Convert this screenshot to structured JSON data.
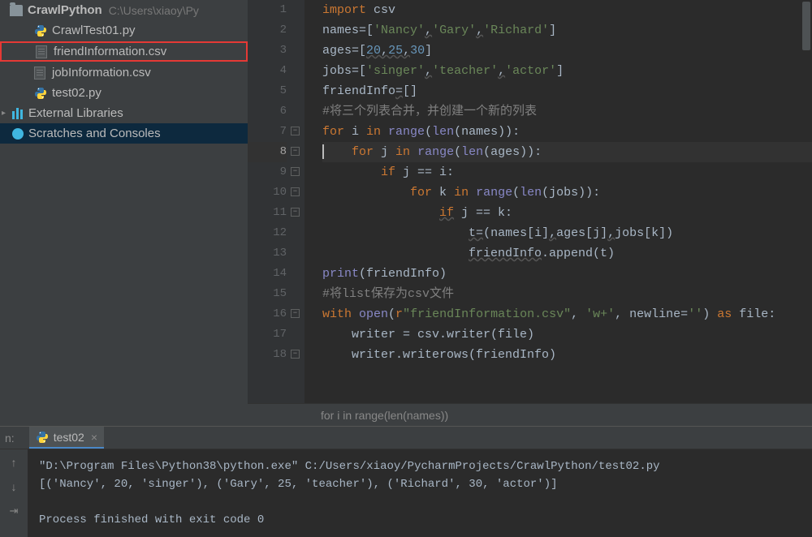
{
  "sidebar": {
    "root": {
      "name": "CrawlPython",
      "path": "C:\\Users\\xiaoy\\Py"
    },
    "files": [
      {
        "name": "CrawlTest01.py",
        "type": "py"
      },
      {
        "name": "friendInformation.csv",
        "type": "csv",
        "highlight": true
      },
      {
        "name": "jobInformation.csv",
        "type": "csv"
      },
      {
        "name": "test02.py",
        "type": "py"
      }
    ],
    "external": "External Libraries",
    "scratches": "Scratches and Consoles"
  },
  "editor": {
    "lines": [
      {
        "n": 1,
        "tokens": [
          [
            "kw",
            "import "
          ],
          [
            "id",
            "csv"
          ]
        ]
      },
      {
        "n": 2,
        "tokens": [
          [
            "id",
            "names"
          ],
          [
            "op",
            "=["
          ],
          [
            "str",
            "'Nancy'"
          ],
          [
            "op uline",
            ","
          ],
          [
            "str",
            "'Gary'"
          ],
          [
            "op uline",
            ","
          ],
          [
            "str",
            "'Richard'"
          ],
          [
            "op",
            "]"
          ]
        ]
      },
      {
        "n": 3,
        "tokens": [
          [
            "id",
            "ages"
          ],
          [
            "op",
            "=["
          ],
          [
            "num uline",
            "20"
          ],
          [
            "op uline",
            ","
          ],
          [
            "num uline",
            "25"
          ],
          [
            "op uline",
            ","
          ],
          [
            "num",
            "30"
          ],
          [
            "op",
            "]"
          ]
        ]
      },
      {
        "n": 4,
        "tokens": [
          [
            "id",
            "jobs"
          ],
          [
            "op",
            "=["
          ],
          [
            "str",
            "'singer'"
          ],
          [
            "op uline",
            ","
          ],
          [
            "str",
            "'teacher'"
          ],
          [
            "op uline",
            ","
          ],
          [
            "str",
            "'actor'"
          ],
          [
            "op",
            "]"
          ]
        ]
      },
      {
        "n": 5,
        "tokens": [
          [
            "id",
            "friendInfo"
          ],
          [
            "op uline",
            "="
          ],
          [
            "op",
            "[]"
          ]
        ]
      },
      {
        "n": 6,
        "tokens": [
          [
            "comment",
            "#将三个列表合并，并创建一个新的列表"
          ]
        ]
      },
      {
        "n": 7,
        "fold": true,
        "tokens": [
          [
            "kw",
            "for "
          ],
          [
            "id",
            "i "
          ],
          [
            "kw",
            "in "
          ],
          [
            "builtin",
            "range"
          ],
          [
            "op",
            "("
          ],
          [
            "builtin",
            "len"
          ],
          [
            "op",
            "(names)):"
          ]
        ]
      },
      {
        "n": 8,
        "fold": true,
        "current": true,
        "tokens": [
          [
            "caret",
            ""
          ],
          [
            "id",
            "    "
          ],
          [
            "kw",
            "for "
          ],
          [
            "id",
            "j "
          ],
          [
            "kw",
            "in "
          ],
          [
            "builtin",
            "range"
          ],
          [
            "op",
            "("
          ],
          [
            "builtin",
            "len"
          ],
          [
            "op",
            "(ages)):"
          ]
        ]
      },
      {
        "n": 9,
        "fold": true,
        "tokens": [
          [
            "id",
            "        "
          ],
          [
            "kw",
            "if "
          ],
          [
            "id",
            "j == i:"
          ]
        ]
      },
      {
        "n": 10,
        "fold": true,
        "tokens": [
          [
            "id",
            "            "
          ],
          [
            "kw",
            "for "
          ],
          [
            "id",
            "k "
          ],
          [
            "kw",
            "in "
          ],
          [
            "builtin",
            "range"
          ],
          [
            "op",
            "("
          ],
          [
            "builtin",
            "len"
          ],
          [
            "op",
            "(jobs)):"
          ]
        ]
      },
      {
        "n": 11,
        "fold": true,
        "tokens": [
          [
            "id",
            "                "
          ],
          [
            "kw uline",
            "if"
          ],
          [
            "id",
            " j == k:"
          ]
        ]
      },
      {
        "n": 12,
        "tokens": [
          [
            "id",
            "                    "
          ],
          [
            "id uline",
            "t"
          ],
          [
            "op uline",
            "="
          ],
          [
            "op",
            "(names[i]"
          ],
          [
            "op uline",
            ","
          ],
          [
            "op",
            "ages[j]"
          ],
          [
            "op uline",
            ","
          ],
          [
            "op",
            "jobs[k])"
          ]
        ]
      },
      {
        "n": 13,
        "tokens": [
          [
            "id",
            "                    "
          ],
          [
            "id uline",
            "friendInfo"
          ],
          [
            "op",
            ".append(t)"
          ]
        ]
      },
      {
        "n": 14,
        "tokens": [
          [
            "builtin",
            "print"
          ],
          [
            "op",
            "(friendInfo)"
          ]
        ]
      },
      {
        "n": 15,
        "tokens": [
          [
            "comment",
            "#将list保存为csv文件"
          ]
        ]
      },
      {
        "n": 16,
        "fold": true,
        "tokens": [
          [
            "kw",
            "with "
          ],
          [
            "builtin",
            "open"
          ],
          [
            "op",
            "("
          ],
          [
            "kw",
            "r"
          ],
          [
            "str",
            "\"friendInformation.csv\""
          ],
          [
            "op",
            ", "
          ],
          [
            "str",
            "'w+'"
          ],
          [
            "op",
            ", "
          ],
          [
            "id",
            "newline"
          ],
          [
            "op",
            "="
          ],
          [
            "str",
            "''"
          ],
          [
            "op",
            ") "
          ],
          [
            "kw",
            "as "
          ],
          [
            "id",
            "file:"
          ]
        ]
      },
      {
        "n": 17,
        "tokens": [
          [
            "id",
            "    writer = csv.writer(file)"
          ]
        ]
      },
      {
        "n": 18,
        "fold": true,
        "tokens": [
          [
            "id",
            "    writer.writerows(friendInfo)"
          ]
        ]
      },
      {
        "n": "",
        "tokens": [
          [
            "",
            ""
          ]
        ]
      }
    ],
    "breadcrumb": "for i in range(len(names))"
  },
  "bottom": {
    "run_label": "n:",
    "tab_name": "test02",
    "tab_close": "×",
    "output": [
      "\"D:\\Program Files\\Python38\\python.exe\" C:/Users/xiaoy/PycharmProjects/CrawlPython/test02.py",
      "[('Nancy', 20, 'singer'), ('Gary', 25, 'teacher'), ('Richard', 30, 'actor')]",
      "",
      "Process finished with exit code 0"
    ]
  }
}
